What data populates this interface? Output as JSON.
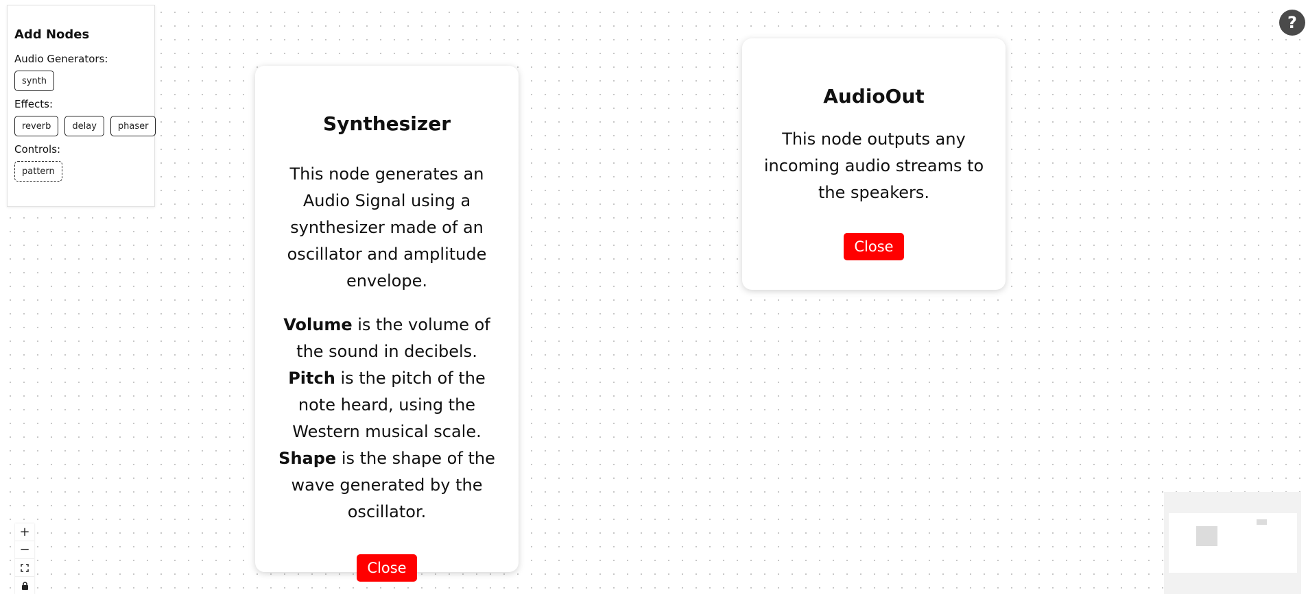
{
  "add_nodes_panel": {
    "title": "Add Nodes",
    "sections": {
      "generators": {
        "label": "Audio Generators:",
        "items": [
          "synth"
        ]
      },
      "effects": {
        "label": "Effects:",
        "items": [
          "reverb",
          "delay",
          "phaser"
        ]
      },
      "controls": {
        "label": "Controls:",
        "items": [
          "pattern"
        ]
      }
    }
  },
  "synth_modal": {
    "title": "Synthesizer",
    "description": "This node generates an Audio Signal using a synthesizer made of an oscillator and amplitude envelope.",
    "params": [
      {
        "name": "Volume",
        "text": " is the volume of the sound in decibels. "
      },
      {
        "name": "Pitch",
        "text": " is the pitch of the note heard, using the Western musical scale. "
      },
      {
        "name": "Shape",
        "text": " is the shape of the wave generated by the oscillator."
      }
    ],
    "close_label": "Close"
  },
  "audioout_modal": {
    "title": "AudioOut",
    "description": "This node outputs any incoming audio streams to the speakers.",
    "close_label": "Close"
  },
  "help": {
    "label": "?"
  },
  "zoom_controls": {
    "zoom_in": "+",
    "zoom_out": "−",
    "fit_view": "⛶",
    "lock": "🔒"
  },
  "colors": {
    "close_button": "#ff0000",
    "help_button": "#4a4a4a",
    "canvas_dot": "#c4c4c4"
  },
  "icons": [
    "plus-icon",
    "minus-icon",
    "fit-view-icon",
    "lock-icon",
    "help-icon"
  ]
}
